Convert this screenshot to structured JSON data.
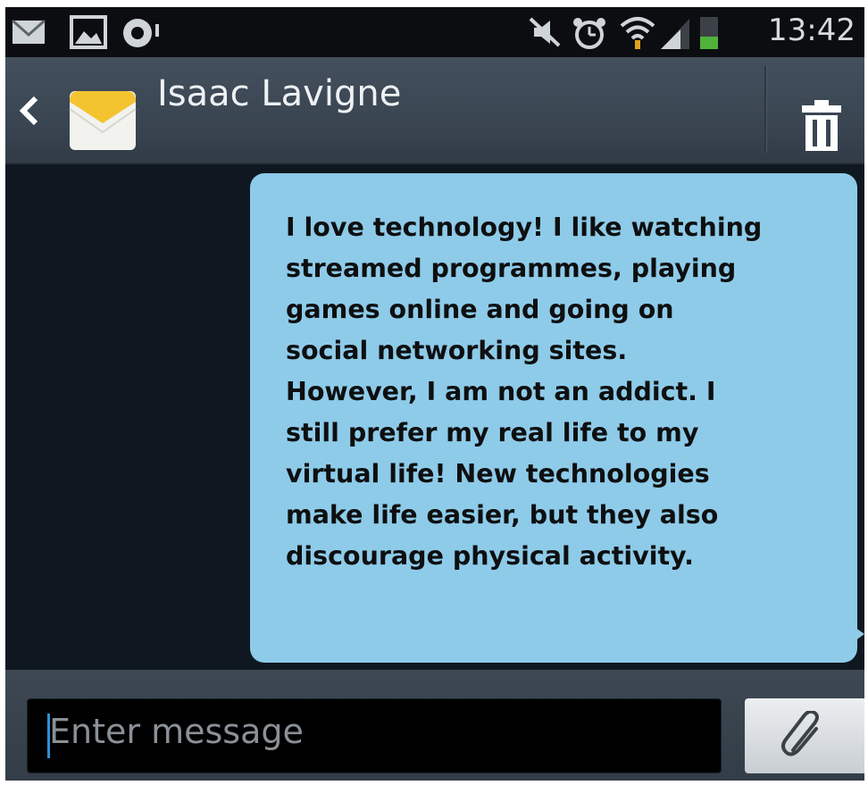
{
  "status_bar": {
    "time": "13:42",
    "icons": [
      "mail-icon",
      "gallery-icon",
      "sync-icon",
      "mute-icon",
      "alarm-icon",
      "wifi-icon",
      "signal-icon",
      "battery-icon"
    ]
  },
  "header": {
    "contact_name": "Isaac Lavigne",
    "icons": [
      "back-arrow-icon",
      "envelope-icon",
      "trash-icon"
    ]
  },
  "conversation": {
    "messages": [
      {
        "text": "I love technology! I like watching\nstreamed programmes, playing\ngames online and going on\nsocial networking sites.\nHowever, I am not an addict. I\nstill prefer my real life to my\nvirtual life! New technologies\nmake life easier, but they also\ndiscourage physical activity.",
        "bubble_color": "#8ecbe9"
      }
    ]
  },
  "composer": {
    "placeholder": "Enter message",
    "attach_icon": "paperclip-icon"
  },
  "colors": {
    "header_bg": "#3a4552",
    "conversation_bg": "#0f1821",
    "bubble": "#8ecbe9",
    "envelope_flap": "#f4c430",
    "caret": "#2f8fd6"
  }
}
